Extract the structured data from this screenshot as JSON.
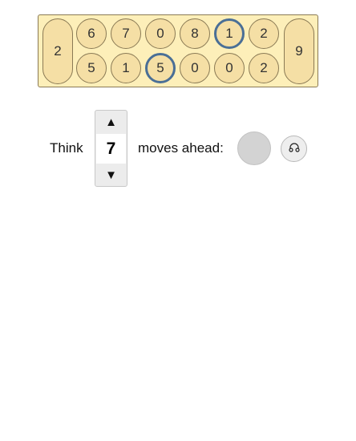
{
  "board": {
    "left_store": "2",
    "right_store": "9",
    "top_row": [
      "6",
      "7",
      "0",
      "8",
      "1",
      "2"
    ],
    "bottom_row": [
      "5",
      "1",
      "5",
      "0",
      "0",
      "2"
    ],
    "highlighted": [
      "top-4",
      "bottom-2"
    ]
  },
  "controls": {
    "think_label": "Think",
    "depth_value": "7",
    "moves_label": "moves ahead:",
    "up_arrow": "▲",
    "down_arrow": "▼"
  },
  "icons": {
    "sound": "headphones-icon"
  },
  "colors": {
    "board_bg": "#fdefb9",
    "pit_bg": "#f5dfa5",
    "highlight_ring": "#4a6f96",
    "status_circle": "#d3d3d3"
  }
}
